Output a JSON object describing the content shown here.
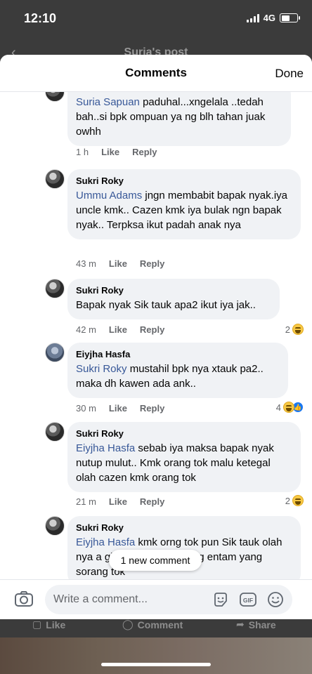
{
  "status": {
    "time": "12:10",
    "network": "4G"
  },
  "background": {
    "post_title": "Suria's post",
    "like": "Like",
    "comment": "Comment",
    "share": "Share"
  },
  "header": {
    "title": "Comments",
    "done": "Done"
  },
  "comments": [
    {
      "author": "",
      "mention": "Suria Sapuan",
      "text": " paduhal...xngelala ..tedah bah..si bpk ompuan ya ng blh tahan juak owhh",
      "time": "1 h",
      "like": "Like",
      "reply": "Reply",
      "reactions": ""
    },
    {
      "author": "Sukri Roky",
      "mention": "Ummu Adams",
      "text": " jngn membabit bapak nyak.iya uncle kmk.. Cazen kmk iya bulak ngn bapak nyak.. Terpksa ikut padah anak nya",
      "time": "43 m",
      "like": "Like",
      "reply": "Reply",
      "reactions": ""
    },
    {
      "author": "Sukri Roky",
      "mention": "",
      "text": "Bapak nyak Sik tauk apa2 ikut iya jak..",
      "time": "42 m",
      "like": "Like",
      "reply": "Reply",
      "reactions": "2"
    },
    {
      "author": "Eiyjha Hasfa",
      "mention": "Sukri Roky",
      "text": " mustahil bpk nya xtauk pa2.. maka dh kawen ada ank..",
      "time": "30 m",
      "like": "Like",
      "reply": "Reply",
      "reactions": "4"
    },
    {
      "author": "Sukri Roky",
      "mention": "Eiyjha Hasfa",
      "text": " sebab iya maksa bapak nyak nutup mulut.. Kmk orang tok malu ketegal olah cazen kmk orang tok",
      "time": "21 m",
      "like": "Like",
      "reply": "Reply",
      "reactions": "2"
    },
    {
      "author": "Sukri Roky",
      "mention": "Eiyjha Hasfa",
      "text": " kmk orng tok pun Sik tauk olah nya a gilak.. Malu kmk orng entam yang sorang tok",
      "time": "",
      "like": "",
      "reply": "",
      "reactions": ""
    }
  ],
  "new_comment_pill": "1 new comment",
  "composer": {
    "placeholder": "Write a comment..."
  },
  "icons": [
    "camera-icon",
    "sticker-icon",
    "gif-icon",
    "emoji-icon",
    "haha-reaction-icon",
    "like-reaction-icon"
  ],
  "colors": {
    "mention": "#385898",
    "bubble": "#f0f2f5",
    "meta": "#65676b",
    "like_blue": "#1877f2"
  }
}
